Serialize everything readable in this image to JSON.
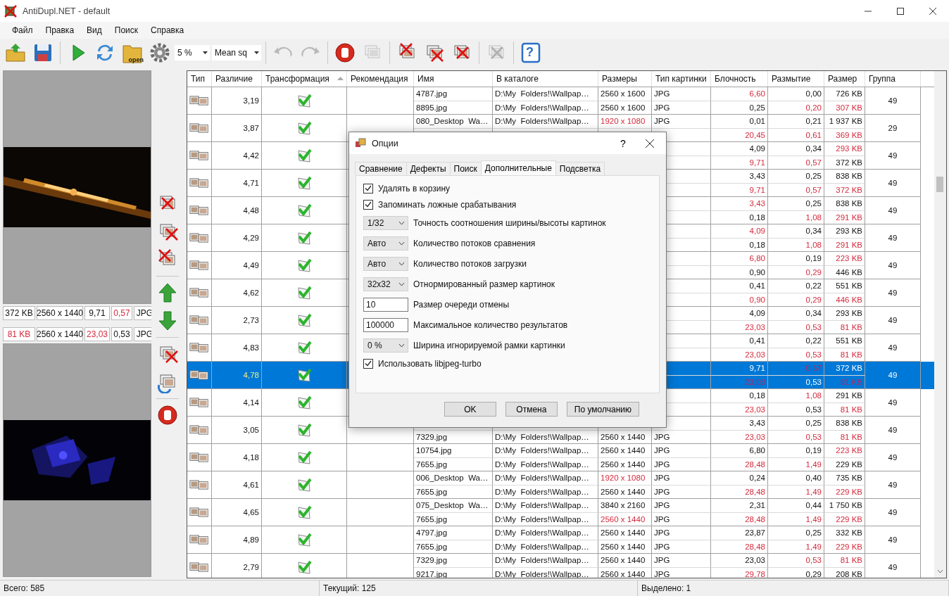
{
  "window": {
    "title": "AntiDupl.NET - default"
  },
  "menu": [
    "Файл",
    "Правка",
    "Вид",
    "Поиск",
    "Справка"
  ],
  "toolbar": {
    "buttons_left": [
      {
        "disabled": false
      },
      {
        "disabled": false
      },
      {
        "disabled": false
      },
      {
        "disabled": false
      },
      {
        "disabled": false,
        "label": "open"
      },
      {
        "disabled": false
      }
    ],
    "threshold": "5 %",
    "method": "Mean sq",
    "buttons_right": [
      {
        "disabled": true
      },
      {
        "disabled": true
      },
      {
        "disabled": false
      },
      {
        "disabled": true
      },
      {
        "disabled": false
      },
      {
        "disabled": false
      },
      {
        "disabled": false
      },
      {
        "disabled": true
      },
      {
        "disabled": false,
        "label": "?"
      }
    ]
  },
  "previews": [
    {
      "size": {
        "text": "372 KB",
        "flagged": false
      },
      "dimensions": {
        "text": "2560 x 1440",
        "flagged": false
      },
      "blockiness": {
        "text": "9,71",
        "flagged": false
      },
      "blur": {
        "text": "0,57",
        "flagged": true
      },
      "image_type": {
        "text": "JPG",
        "flagged": false
      }
    },
    {
      "size": {
        "text": "81 KB",
        "flagged": true
      },
      "dimensions": {
        "text": "2560 x 1440",
        "flagged": false
      },
      "blockiness": {
        "text": "23,03",
        "flagged": true
      },
      "blur": {
        "text": "0,53",
        "flagged": false
      },
      "image_type": {
        "text": "JPG",
        "flagged": false
      }
    }
  ],
  "table": {
    "columns": [
      {
        "label": "Тип",
        "sorted": false
      },
      {
        "label": "Различие",
        "sorted": false
      },
      {
        "label": "Трансформация",
        "sorted": true
      },
      {
        "label": "Рекомендация",
        "sorted": false
      },
      {
        "label": "Имя",
        "sorted": false
      },
      {
        "label": "В каталоге",
        "sorted": false
      },
      {
        "label": "Размеры",
        "sorted": false
      },
      {
        "label": "Тип картинки",
        "sorted": false
      },
      {
        "label": "Блочность",
        "sorted": false
      },
      {
        "label": "Размытие",
        "sorted": false
      },
      {
        "label": "Размер",
        "sorted": false
      },
      {
        "label": "Группа",
        "sorted": false
      }
    ],
    "rows": [
      {
        "difference": "3,19",
        "group": "49",
        "selected": false,
        "items": [
          {
            "name": "4787.jpg",
            "folder": "D:\\My  Folders!\\Wallpap…",
            "dimensions": {
              "text": "2560 x 1600",
              "flagged": false
            },
            "image_type": "JPG",
            "blockiness": {
              "text": "6,60",
              "flagged": true
            },
            "blur": {
              "text": "0,00",
              "flagged": false
            },
            "size": {
              "text": "726 KB",
              "flagged": false
            }
          },
          {
            "name": "8895.jpg",
            "folder": "D:\\My  Folders!\\Wallpap…",
            "dimensions": {
              "text": "2560 x 1600",
              "flagged": false
            },
            "image_type": "JPG",
            "blockiness": {
              "text": "0,25",
              "flagged": false
            },
            "blur": {
              "text": "0,20",
              "flagged": true
            },
            "size": {
              "text": "307 KB",
              "flagged": true
            }
          }
        ]
      },
      {
        "difference": "3,87",
        "group": "29",
        "selected": false,
        "items": [
          {
            "name": "080_Desktop  Wa…",
            "folder": "D:\\My  Folders!\\Wallpap…",
            "dimensions": {
              "text": "1920 x 1080",
              "flagged": true
            },
            "image_type": "JPG",
            "blockiness": {
              "text": "0,01",
              "flagged": false
            },
            "blur": {
              "text": "0,21",
              "flagged": false
            },
            "size": {
              "text": "1 937 KB",
              "flagged": false
            }
          },
          {
            "blockiness": {
              "text": "20,45",
              "flagged": true
            },
            "blur": {
              "text": "0,61",
              "flagged": true
            },
            "size": {
              "text": "369 KB",
              "flagged": true
            }
          }
        ]
      },
      {
        "difference": "4,42",
        "group": "49",
        "selected": false,
        "items": [
          {
            "blockiness": {
              "text": "4,09",
              "flagged": false
            },
            "blur": {
              "text": "0,34",
              "flagged": false
            },
            "size": {
              "text": "293 KB",
              "flagged": true
            }
          },
          {
            "blockiness": {
              "text": "9,71",
              "flagged": true
            },
            "blur": {
              "text": "0,57",
              "flagged": true
            },
            "size": {
              "text": "372 KB",
              "flagged": false
            }
          }
        ]
      },
      {
        "difference": "4,71",
        "group": "49",
        "selected": false,
        "items": [
          {
            "blockiness": {
              "text": "3,43",
              "flagged": false
            },
            "blur": {
              "text": "0,25",
              "flagged": false
            },
            "size": {
              "text": "838 KB",
              "flagged": false
            }
          },
          {
            "blockiness": {
              "text": "9,71",
              "flagged": true
            },
            "blur": {
              "text": "0,57",
              "flagged": true
            },
            "size": {
              "text": "372 KB",
              "flagged": true
            }
          }
        ]
      },
      {
        "difference": "4,48",
        "group": "49",
        "selected": false,
        "items": [
          {
            "blockiness": {
              "text": "3,43",
              "flagged": true
            },
            "blur": {
              "text": "0,25",
              "flagged": false
            },
            "size": {
              "text": "838 KB",
              "flagged": false
            }
          },
          {
            "blockiness": {
              "text": "0,18",
              "flagged": false
            },
            "blur": {
              "text": "1,08",
              "flagged": true
            },
            "size": {
              "text": "291 KB",
              "flagged": true
            }
          }
        ]
      },
      {
        "difference": "4,29",
        "group": "49",
        "selected": false,
        "items": [
          {
            "blockiness": {
              "text": "4,09",
              "flagged": true
            },
            "blur": {
              "text": "0,34",
              "flagged": false
            },
            "size": {
              "text": "293 KB",
              "flagged": false
            }
          },
          {
            "blockiness": {
              "text": "0,18",
              "flagged": false
            },
            "blur": {
              "text": "1,08",
              "flagged": true
            },
            "size": {
              "text": "291 KB",
              "flagged": true
            }
          }
        ]
      },
      {
        "difference": "4,49",
        "group": "49",
        "selected": false,
        "items": [
          {
            "blockiness": {
              "text": "6,80",
              "flagged": true
            },
            "blur": {
              "text": "0,19",
              "flagged": false
            },
            "size": {
              "text": "223 KB",
              "flagged": true
            }
          },
          {
            "blockiness": {
              "text": "0,90",
              "flagged": false
            },
            "blur": {
              "text": "0,29",
              "flagged": true
            },
            "size": {
              "text": "446 KB",
              "flagged": false
            }
          }
        ]
      },
      {
        "difference": "4,62",
        "group": "49",
        "selected": false,
        "items": [
          {
            "blockiness": {
              "text": "0,41",
              "flagged": false
            },
            "blur": {
              "text": "0,22",
              "flagged": false
            },
            "size": {
              "text": "551 KB",
              "flagged": false
            }
          },
          {
            "blockiness": {
              "text": "0,90",
              "flagged": true
            },
            "blur": {
              "text": "0,29",
              "flagged": true
            },
            "size": {
              "text": "446 KB",
              "flagged": true
            }
          }
        ]
      },
      {
        "difference": "2,73",
        "group": "49",
        "selected": false,
        "items": [
          {
            "blockiness": {
              "text": "4,09",
              "flagged": false
            },
            "blur": {
              "text": "0,34",
              "flagged": false
            },
            "size": {
              "text": "293 KB",
              "flagged": false
            }
          },
          {
            "blockiness": {
              "text": "23,03",
              "flagged": true
            },
            "blur": {
              "text": "0,53",
              "flagged": true
            },
            "size": {
              "text": "81 KB",
              "flagged": true
            }
          }
        ]
      },
      {
        "difference": "4,83",
        "group": "49",
        "selected": false,
        "items": [
          {
            "blockiness": {
              "text": "0,41",
              "flagged": false
            },
            "blur": {
              "text": "0,22",
              "flagged": false
            },
            "size": {
              "text": "551 KB",
              "flagged": false
            }
          },
          {
            "blockiness": {
              "text": "23,03",
              "flagged": true
            },
            "blur": {
              "text": "0,53",
              "flagged": true
            },
            "size": {
              "text": "81 KB",
              "flagged": true
            }
          }
        ]
      },
      {
        "difference": "4,78",
        "group": "49",
        "selected": true,
        "items": [
          {
            "blockiness": {
              "text": "9,71",
              "flagged": false
            },
            "blur": {
              "text": "0,57",
              "flagged": true
            },
            "size": {
              "text": "372 KB",
              "flagged": false
            }
          },
          {
            "blockiness": {
              "text": "23,03",
              "flagged": true
            },
            "blur": {
              "text": "0,53",
              "flagged": false
            },
            "size": {
              "text": "81 KB",
              "flagged": true
            }
          }
        ]
      },
      {
        "difference": "4,14",
        "group": "49",
        "selected": false,
        "items": [
          {
            "blockiness": {
              "text": "0,18",
              "flagged": false
            },
            "blur": {
              "text": "1,08",
              "flagged": true
            },
            "size": {
              "text": "291 KB",
              "flagged": false
            }
          },
          {
            "blockiness": {
              "text": "23,03",
              "flagged": true
            },
            "blur": {
              "text": "0,53",
              "flagged": false
            },
            "size": {
              "text": "81 KB",
              "flagged": true
            }
          }
        ]
      },
      {
        "difference": "3,05",
        "group": "49",
        "selected": false,
        "items": [
          {
            "blockiness": {
              "text": "3,43",
              "flagged": false
            },
            "blur": {
              "text": "0,25",
              "flagged": false
            },
            "size": {
              "text": "838 KB",
              "flagged": false
            }
          },
          {
            "name": "7329.jpg",
            "folder": "D:\\My  Folders!\\Wallpap…",
            "dimensions": {
              "text": "2560 x 1440",
              "flagged": false
            },
            "image_type": "JPG",
            "blockiness": {
              "text": "23,03",
              "flagged": true
            },
            "blur": {
              "text": "0,53",
              "flagged": true
            },
            "size": {
              "text": "81 KB",
              "flagged": true
            }
          }
        ]
      },
      {
        "difference": "4,18",
        "group": "49",
        "selected": false,
        "items": [
          {
            "name": "10754.jpg",
            "folder": "D:\\My  Folders!\\Wallpap…",
            "dimensions": {
              "text": "2560 x 1440",
              "flagged": false
            },
            "image_type": "JPG",
            "blockiness": {
              "text": "6,80",
              "flagged": false
            },
            "blur": {
              "text": "0,19",
              "flagged": false
            },
            "size": {
              "text": "223 KB",
              "flagged": true
            }
          },
          {
            "name": "7655.jpg",
            "folder": "D:\\My  Folders!\\Wallpap…",
            "dimensions": {
              "text": "2560 x 1440",
              "flagged": false
            },
            "image_type": "JPG",
            "blockiness": {
              "text": "28,48",
              "flagged": true
            },
            "blur": {
              "text": "1,49",
              "flagged": true
            },
            "size": {
              "text": "229 KB",
              "flagged": false
            }
          }
        ]
      },
      {
        "difference": "4,61",
        "group": "49",
        "selected": false,
        "items": [
          {
            "name": "006_Desktop  Wa…",
            "folder": "D:\\My  Folders!\\Wallpap…",
            "dimensions": {
              "text": "1920 x 1080",
              "flagged": true
            },
            "image_type": "JPG",
            "blockiness": {
              "text": "0,24",
              "flagged": false
            },
            "blur": {
              "text": "0,40",
              "flagged": false
            },
            "size": {
              "text": "735 KB",
              "flagged": false
            }
          },
          {
            "name": "7655.jpg",
            "folder": "D:\\My  Folders!\\Wallpap…",
            "dimensions": {
              "text": "2560 x 1440",
              "flagged": false
            },
            "image_type": "JPG",
            "blockiness": {
              "text": "28,48",
              "flagged": true
            },
            "blur": {
              "text": "1,49",
              "flagged": true
            },
            "size": {
              "text": "229 KB",
              "flagged": true
            }
          }
        ]
      },
      {
        "difference": "4,65",
        "group": "49",
        "selected": false,
        "items": [
          {
            "name": "075_Desktop  Wa…",
            "folder": "D:\\My  Folders!\\Wallpap…",
            "dimensions": {
              "text": "3840 x 2160",
              "flagged": false
            },
            "image_type": "JPG",
            "blockiness": {
              "text": "2,31",
              "flagged": false
            },
            "blur": {
              "text": "0,44",
              "flagged": false
            },
            "size": {
              "text": "1 750 KB",
              "flagged": false
            }
          },
          {
            "name": "7655.jpg",
            "folder": "D:\\My  Folders!\\Wallpap…",
            "dimensions": {
              "text": "2560 x 1440",
              "flagged": true
            },
            "image_type": "JPG",
            "blockiness": {
              "text": "28,48",
              "flagged": true
            },
            "blur": {
              "text": "1,49",
              "flagged": true
            },
            "size": {
              "text": "229 KB",
              "flagged": true
            }
          }
        ]
      },
      {
        "difference": "4,89",
        "group": "49",
        "selected": false,
        "items": [
          {
            "name": "4797.jpg",
            "folder": "D:\\My  Folders!\\Wallpap…",
            "dimensions": {
              "text": "2560 x 1440",
              "flagged": false
            },
            "image_type": "JPG",
            "blockiness": {
              "text": "23,87",
              "flagged": false
            },
            "blur": {
              "text": "0,25",
              "flagged": false
            },
            "size": {
              "text": "332 KB",
              "flagged": false
            }
          },
          {
            "name": "7655.jpg",
            "folder": "D:\\My  Folders!\\Wallpap…",
            "dimensions": {
              "text": "2560 x 1440",
              "flagged": false
            },
            "image_type": "JPG",
            "blockiness": {
              "text": "28,48",
              "flagged": true
            },
            "blur": {
              "text": "1,49",
              "flagged": true
            },
            "size": {
              "text": "229 KB",
              "flagged": true
            }
          }
        ]
      },
      {
        "difference": "2,79",
        "group": "49",
        "selected": false,
        "items": [
          {
            "name": "7329.jpg",
            "folder": "D:\\My  Folders!\\Wallpap…",
            "dimensions": {
              "text": "2560 x 1440",
              "flagged": false
            },
            "image_type": "JPG",
            "blockiness": {
              "text": "23,03",
              "flagged": false
            },
            "blur": {
              "text": "0,53",
              "flagged": true
            },
            "size": {
              "text": "81 KB",
              "flagged": true
            }
          },
          {
            "name": "9217.jpg",
            "folder": "D:\\My  Folders!\\Wallpap…",
            "dimensions": {
              "text": "2560 x 1440",
              "flagged": false
            },
            "image_type": "JPG",
            "blockiness": {
              "text": "29,78",
              "flagged": true
            },
            "blur": {
              "text": "0,29",
              "flagged": false
            },
            "size": {
              "text": "208 KB",
              "flagged": false
            }
          }
        ]
      }
    ]
  },
  "status_bar": [
    "Всего: 585",
    "Текущий: 125",
    "Выделено: 1"
  ],
  "dialog": {
    "title": "Опции",
    "help": "?",
    "tabs": [
      {
        "label": "Сравнение",
        "selected": false
      },
      {
        "label": "Дефекты",
        "selected": false
      },
      {
        "label": "Поиск",
        "selected": false
      },
      {
        "label": "Дополнительные",
        "selected": true
      },
      {
        "label": "Подсветка",
        "selected": false
      }
    ],
    "options": [
      {
        "kind": "checkbox",
        "caption": "Удалять в корзину",
        "checked": true
      },
      {
        "kind": "checkbox",
        "caption": "Запоминать ложные срабатывания",
        "checked": true
      },
      {
        "kind": "select",
        "value": "1/32",
        "label": "Точность соотношения ширины/высоты картинок"
      },
      {
        "kind": "select",
        "value": "Авто",
        "label": "Количество потоков сравнения"
      },
      {
        "kind": "select",
        "value": "Авто",
        "label": "Количество потоков загрузки"
      },
      {
        "kind": "select",
        "value": "32x32",
        "label": "Отнормированный размер картинок"
      },
      {
        "kind": "input",
        "value": "10",
        "label": "Размер очереди отмены"
      },
      {
        "kind": "input",
        "value": "100000",
        "label": "Максимальное количество результатов"
      },
      {
        "kind": "select",
        "value": "0 %",
        "label": "Ширина игнорируемой рамки картинки"
      },
      {
        "kind": "checkbox",
        "caption": "Использовать libjpeg-turbo",
        "checked": true
      }
    ],
    "buttons": [
      "OK",
      "Отмена",
      "По умолчанию"
    ]
  }
}
